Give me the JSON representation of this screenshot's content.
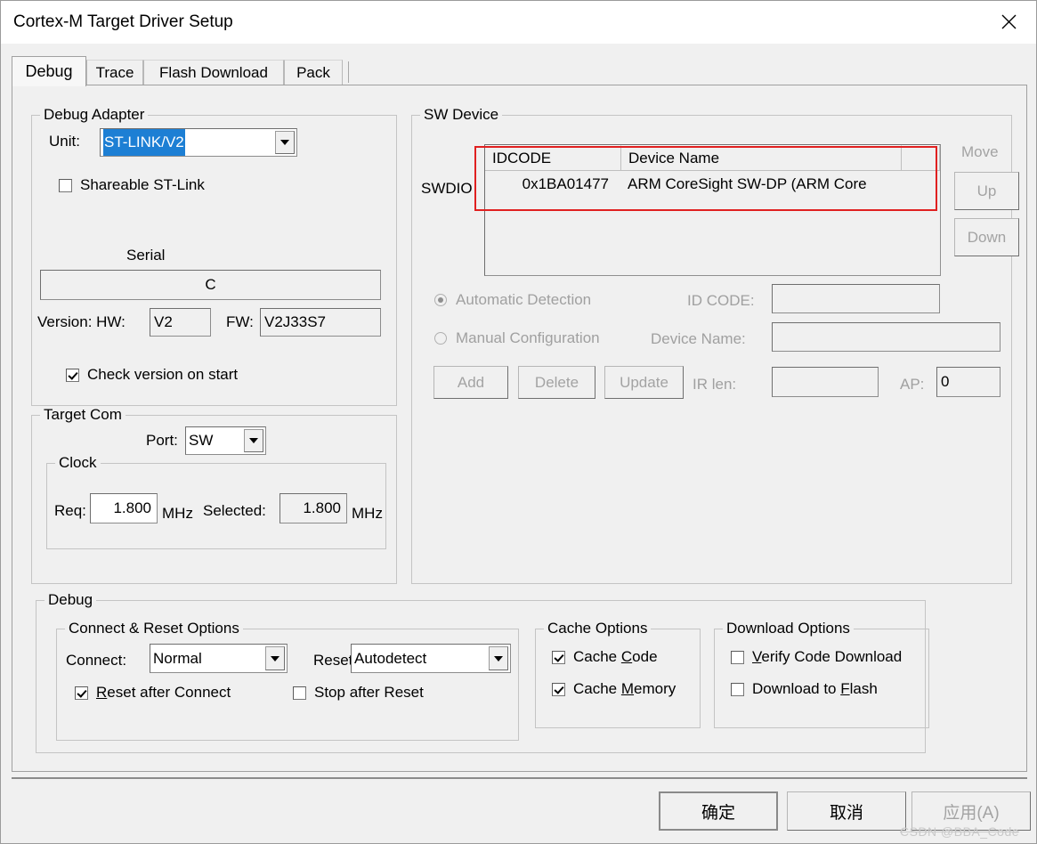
{
  "window": {
    "title": "Cortex-M Target Driver Setup",
    "close_icon": "close-icon"
  },
  "tabs": [
    {
      "label": "Debug",
      "active": true
    },
    {
      "label": "Trace",
      "active": false
    },
    {
      "label": "Flash Download",
      "active": false
    },
    {
      "label": "Pack",
      "active": false
    }
  ],
  "debug_adapter": {
    "legend": "Debug Adapter",
    "unit_label": "Unit:",
    "unit_value": "ST-LINK/V2",
    "shareable_label": "Shareable ST-Link",
    "shareable_checked": false,
    "serial_label": "Serial",
    "serial_value": "C",
    "version_label": "Version: HW:",
    "hw_value": "V2",
    "fw_label": "FW:",
    "fw_value": "V2J33S7",
    "check_version_label": "Check version on start",
    "check_version_checked": true
  },
  "target_com": {
    "legend": "Target Com",
    "port_label": "Port:",
    "port_value": "SW",
    "clock_legend": "Clock",
    "req_label": "Req:",
    "req_value": "1.800",
    "req_unit": "MHz",
    "selected_label": "Selected:",
    "selected_value": "1.800",
    "selected_unit": "MHz"
  },
  "sw_device": {
    "legend": "SW Device",
    "swdio_label": "SWDIO",
    "columns": [
      "IDCODE",
      "Device Name"
    ],
    "rows": [
      {
        "idcode": "0x1BA01477",
        "device_name": "ARM CoreSight SW-DP (ARM Core"
      }
    ],
    "move_label": "Move",
    "up_label": "Up",
    "down_label": "Down",
    "automatic_detection_label": "Automatic Detection",
    "automatic_detection_selected": true,
    "manual_configuration_label": "Manual Configuration",
    "manual_configuration_selected": false,
    "id_code_label": "ID CODE:",
    "id_code_value": "",
    "device_name_label": "Device Name:",
    "device_name_value": "",
    "ir_len_label": "IR len:",
    "ir_len_value": "",
    "ap_label": "AP:",
    "ap_value": "0",
    "add_label": "Add",
    "delete_label": "Delete",
    "update_label": "Update"
  },
  "debug_section": {
    "legend": "Debug",
    "connect_reset": {
      "legend": "Connect & Reset Options",
      "connect_label": "Connect:",
      "connect_value": "Normal",
      "reset_label": "Reset:",
      "reset_value": "Autodetect",
      "reset_after_connect_label": "Reset after Connect",
      "reset_after_connect_checked": true,
      "stop_after_reset_label": "Stop after Reset",
      "stop_after_reset_checked": false
    },
    "cache": {
      "legend": "Cache Options",
      "cache_code_label": "Cache Code",
      "cache_code_checked": true,
      "cache_memory_label": "Cache Memory",
      "cache_memory_checked": true
    },
    "download": {
      "legend": "Download Options",
      "verify_code_download_label": "Verify Code Download",
      "verify_code_download_checked": false,
      "download_to_flash_label": "Download to Flash",
      "download_to_flash_checked": false
    }
  },
  "footer": {
    "ok_label": "确定",
    "cancel_label": "取消",
    "apply_label": "应用(A)",
    "apply_disabled": true
  },
  "watermark": "CSDN @BBA_Code",
  "colors": {
    "selection_blue": "#1d7fd4",
    "annotation_red": "#e02020",
    "dialog_bg": "#f0f0f0"
  }
}
